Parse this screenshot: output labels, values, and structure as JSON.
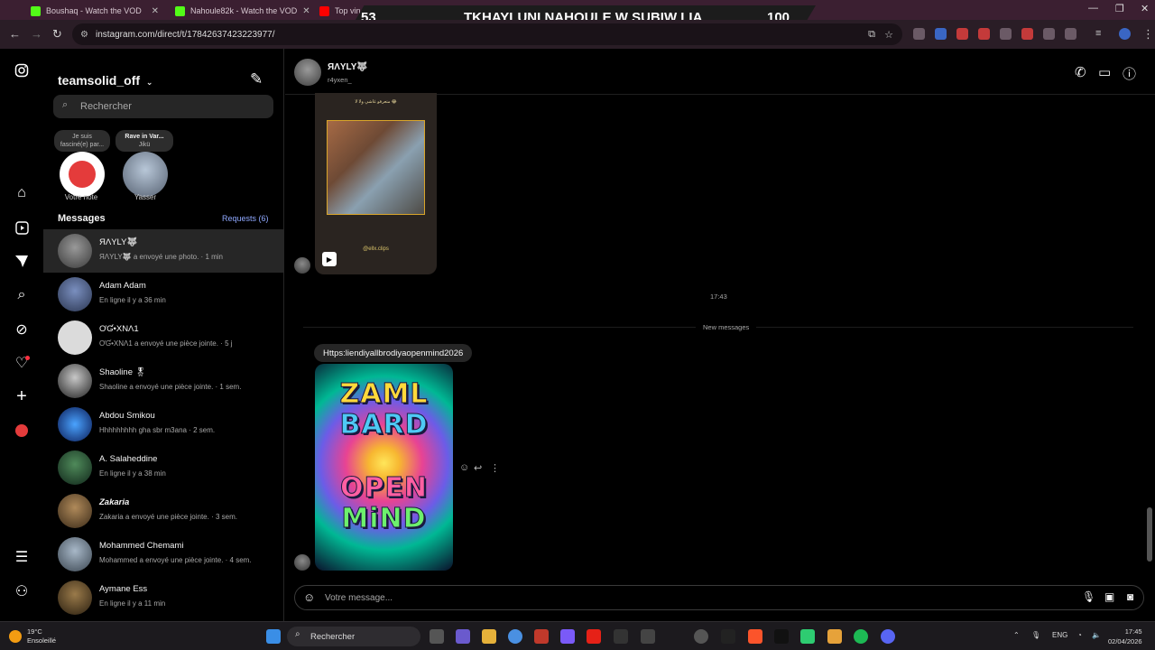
{
  "browser": {
    "tabs": [
      {
        "label": "Boushaq - Watch the VOD",
        "color": "#53fc18"
      },
      {
        "label": "Nahoule82k - Watch the VOD",
        "color": "#53fc18"
      },
      {
        "label": "Top vin",
        "color": "#ff0000"
      }
    ],
    "url": "instagram.com/direct/t/17842637423223977/"
  },
  "overlay": {
    "left_num": "53",
    "title": "TKHAYLUNI NAHOULE W SUBIW LIA",
    "right_num": "100"
  },
  "rail": {
    "icons": [
      "instagram-icon",
      "home-icon",
      "reels-icon",
      "messages-icon",
      "search-icon",
      "explore-icon",
      "notifications-icon",
      "create-icon",
      "profile-icon",
      "menu-icon",
      "apps-icon"
    ]
  },
  "inbox": {
    "account": "teamsolid_off",
    "search_placeholder": "Rechercher",
    "notes": [
      {
        "bubble": "Je suis fasciné(e) par...",
        "label": "Votre note"
      },
      {
        "bubble": "Rave in Var...",
        "bubble2": "Jikü",
        "label": "Yasser"
      }
    ],
    "section_title": "Messages",
    "requests": "Requests (6)",
    "conversations": [
      {
        "name": "ЯΛYLY🐺",
        "sub": "ЯΛYLY🐺 a envoyé une photo. · 1 min",
        "color": "#555"
      },
      {
        "name": "Adam Adam",
        "sub": "En ligne il y a 36 min",
        "color": "#3d4a6b"
      },
      {
        "name": "ƠƓ•XNΛ1",
        "sub": "ƠƓ•XNΛ1 a envoyé une pièce jointe. · 5 j",
        "color": "#d9d9d9"
      },
      {
        "name": "Shaoline 🎖",
        "sub": "Shaoline a envoyé une pièce jointe. · 1 sem.",
        "color": "#4a4a4a"
      },
      {
        "name": "Abdou Smikou",
        "sub": "Hhhhhhhhh gha sbr m3ana · 2 sem.",
        "color": "#1f3a8a"
      },
      {
        "name": "A. Salaheddine",
        "sub": "En ligne il y a 38 min",
        "color": "#1d4d2a"
      },
      {
        "name": "Zakaria",
        "sub": "Zakaria a envoyé une pièce jointe. · 3 sem.",
        "color": "#6b5536"
      },
      {
        "name": "Mohammed Chemami",
        "sub": "Mohammed a envoyé une pièce jointe. · 4 sem.",
        "color": "#5f6b75"
      },
      {
        "name": "Aymane Ess",
        "sub": "En ligne il y a 11 min",
        "color": "#4b3a22"
      }
    ]
  },
  "chat": {
    "name": "ЯΛYLY🐺",
    "username": "r4yxen_",
    "reel_caption_top": "متعرفو غاشي ولا لا 😂",
    "reel_caption_bottom": "@ellx.clips",
    "timestamp": "17:43",
    "divider": "New messages",
    "link_text": "Https:liendiyallbrodiyaopenmind2026",
    "poster_lines": [
      "ZAML",
      "BARD",
      "OPEN",
      "MiND"
    ],
    "composer_placeholder": "Votre message..."
  },
  "taskbar": {
    "temp": "19°C",
    "weather": "Ensoleillé",
    "search": "Rechercher",
    "lang": "ENG",
    "time": "17:45",
    "date": "02/04/2026"
  }
}
